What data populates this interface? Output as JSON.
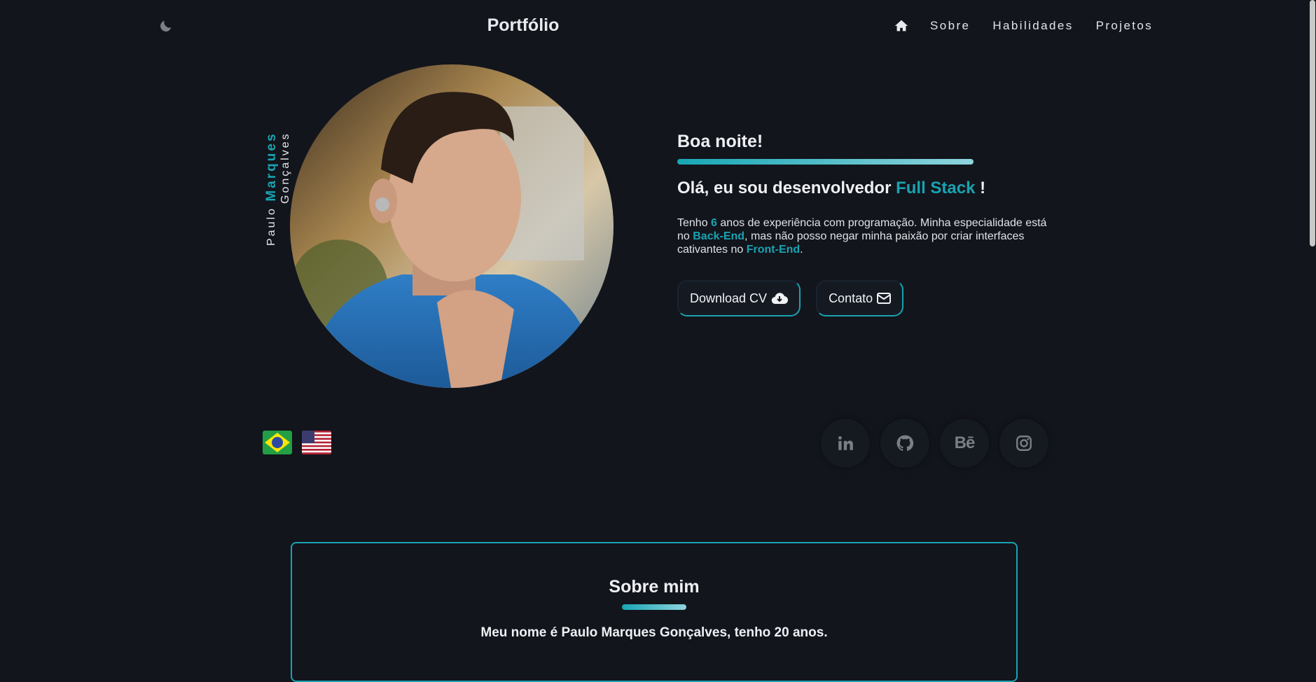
{
  "header": {
    "brand": "Portfólio",
    "nav": [
      "Sobre",
      "Habilidades",
      "Projetos"
    ],
    "icons": {
      "theme": "moon-icon",
      "home": "home-icon"
    }
  },
  "profile": {
    "first_name": "Paulo",
    "middle_name": "Marques",
    "last_name": "Gonçalves"
  },
  "hero": {
    "greeting": "Boa noite!",
    "headline_prefix": "Olá, eu sou desenvolvedor ",
    "headline_accent": "Full Stack",
    "headline_suffix": " !",
    "desc": {
      "p1": "Tenho ",
      "years": "6",
      "p2": " anos de experiência com programação. Minha especialidade está no ",
      "backend": "Back-End",
      "p3": ", mas não posso negar minha paixão por criar interfaces cativantes no ",
      "frontend": "Front-End",
      "p4": "."
    },
    "buttons": {
      "download": "Download CV",
      "contact": "Contato"
    }
  },
  "languages": [
    "brazil-flag-icon",
    "usa-flag-icon"
  ],
  "socials": {
    "behance_text": "Bē",
    "icons": [
      "linkedin-icon",
      "github-icon",
      "behance-icon",
      "instagram-icon"
    ]
  },
  "about": {
    "title": "Sobre mim",
    "intro": "Meu nome é Paulo Marques Gonçalves, tenho 20 anos."
  },
  "colors": {
    "accent": "#19a3b1",
    "background": "#12151c",
    "text": "#e6e8ec"
  }
}
